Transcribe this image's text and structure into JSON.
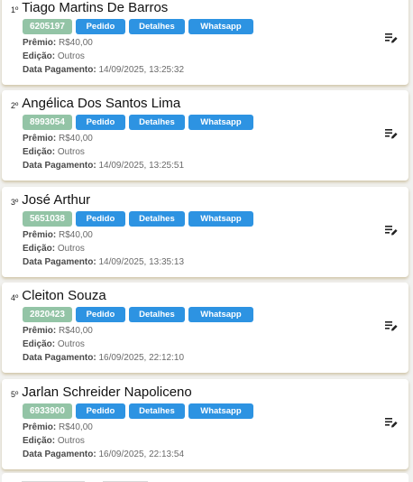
{
  "labels": {
    "premio": "Prêmio:",
    "edicao": "Edição:",
    "data_pagamento": "Data Pagamento:",
    "pedido_button": "Pedido",
    "detalhes_button": "Detalhes",
    "whatsapp_button": "Whatsapp"
  },
  "entries": [
    {
      "rank": "1º",
      "name": "Tiago Martins De Barros",
      "code": "6205197",
      "premio": "R$40,00",
      "edicao": "Outros",
      "data_pagamento": "14/09/2025, 13:25:32"
    },
    {
      "rank": "2º",
      "name": "Angélica Dos Santos Lima",
      "code": "8993054",
      "premio": "R$40,00",
      "edicao": "Outros",
      "data_pagamento": "14/09/2025, 13:25:51"
    },
    {
      "rank": "3º",
      "name": "José Arthur",
      "code": "5651038",
      "premio": "R$40,00",
      "edicao": "Outros",
      "data_pagamento": "14/09/2025, 13:35:13"
    },
    {
      "rank": "4º",
      "name": "Cleiton Souza",
      "code": "2820423",
      "premio": "R$40,00",
      "edicao": "Outros",
      "data_pagamento": "16/09/2025, 22:12:10"
    },
    {
      "rank": "5º",
      "name": "Jarlan Schreider Napoliceno",
      "code": "6933900",
      "premio": "R$40,00",
      "edicao": "Outros",
      "data_pagamento": "16/09/2025, 22:13:54"
    }
  ],
  "icons": {
    "edit": "edit-list-icon"
  },
  "colors": {
    "code_badge": "#93c4a6",
    "button": "#2d93e2",
    "card_shadow": "#e6dcc0"
  }
}
